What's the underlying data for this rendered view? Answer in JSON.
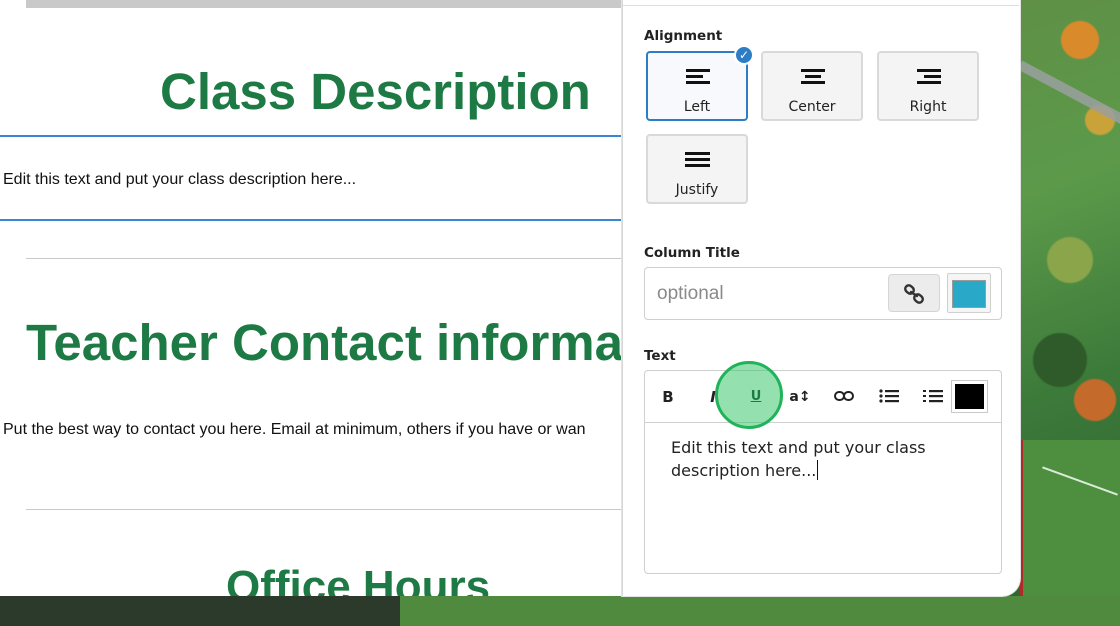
{
  "document": {
    "sections": [
      {
        "title": "Class Description",
        "text": "Edit this text and put your class description here..."
      },
      {
        "title": "Teacher Contact informa",
        "text": "Put the best way to contact you here.  Email at minimum, others if you have or wan"
      },
      {
        "title": "Office Hours"
      }
    ]
  },
  "panel": {
    "alignment": {
      "label": "Alignment",
      "options": [
        {
          "label": "Left",
          "selected": true
        },
        {
          "label": "Center",
          "selected": false
        },
        {
          "label": "Right",
          "selected": false
        },
        {
          "label": "Justify",
          "selected": false
        }
      ]
    },
    "column_title": {
      "label": "Column Title",
      "placeholder": "optional",
      "value": "",
      "link_icon": "link-icon",
      "color": "#29a8c8"
    },
    "text": {
      "label": "Text",
      "toolbar": {
        "bold": "B",
        "italic": "I",
        "underline": "U",
        "font_size": "a↕",
        "link_icon": "link-icon",
        "bullet_list_icon": "bullet-list-icon",
        "numbered_list_icon": "numbered-list-icon",
        "color": "#000000"
      },
      "content": "Edit this text and put your class description here..."
    }
  },
  "colors": {
    "heading": "#1e7a44",
    "accent": "#2d7cc6",
    "click_highlight": "#1fb35a"
  }
}
